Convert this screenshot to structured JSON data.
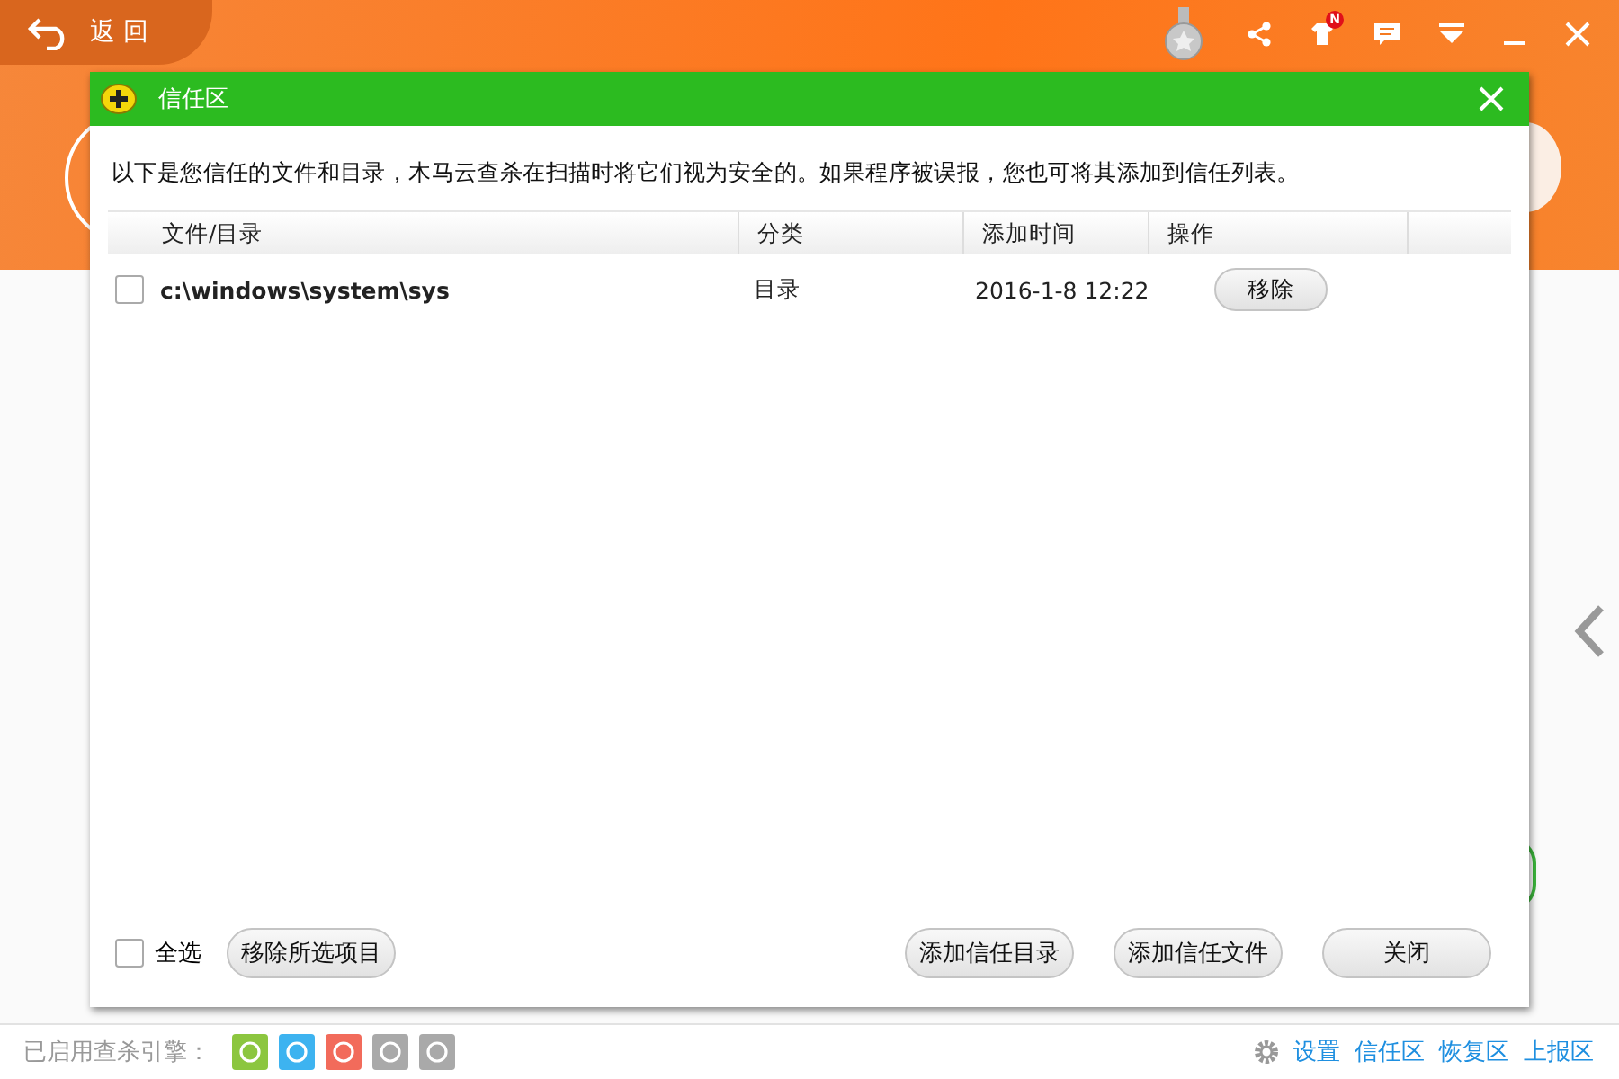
{
  "header": {
    "back_label": "返 回",
    "notification_badge": "N"
  },
  "dialog": {
    "title": "信任区",
    "description": "以下是您信任的文件和目录，木马云查杀在扫描时将它们视为安全的。如果程序被误报，您也可将其添加到信任列表。",
    "table": {
      "columns": [
        "文件/目录",
        "分类",
        "添加时间",
        "操作"
      ],
      "rows": [
        {
          "path": "c:\\windows\\system\\sys",
          "category": "目录",
          "time": "2016-1-8 12:22",
          "action": "移除",
          "checked": false
        }
      ]
    },
    "select_all": {
      "label": "全选",
      "checked": false
    },
    "remove_selected": "移除所选项目",
    "buttons": [
      "添加信任目录",
      "添加信任文件",
      "关闭"
    ]
  },
  "status_bar": {
    "engines_label": "已启用查杀引擎：",
    "engines": [
      {
        "color": "#8cc63f"
      },
      {
        "color": "#3db3f0"
      },
      {
        "color": "#f26b5b"
      },
      {
        "color": "#a9a9a9"
      },
      {
        "color": "#a9a9a9"
      }
    ],
    "links": [
      "设置",
      "信任区",
      "恢复区",
      "上报区"
    ]
  }
}
